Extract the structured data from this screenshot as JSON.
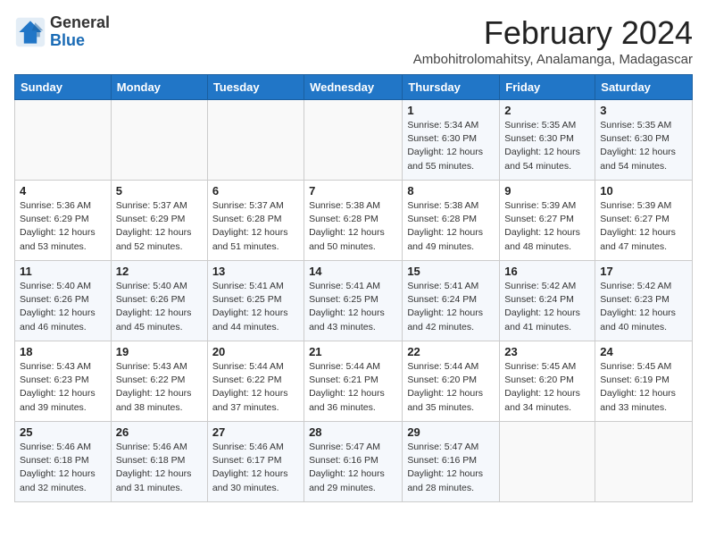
{
  "header": {
    "logo_general": "General",
    "logo_blue": "Blue",
    "title": "February 2024",
    "subtitle": "Ambohitrolomahitsy, Analamanga, Madagascar"
  },
  "weekdays": [
    "Sunday",
    "Monday",
    "Tuesday",
    "Wednesday",
    "Thursday",
    "Friday",
    "Saturday"
  ],
  "weeks": [
    [
      {
        "day": "",
        "info": ""
      },
      {
        "day": "",
        "info": ""
      },
      {
        "day": "",
        "info": ""
      },
      {
        "day": "",
        "info": ""
      },
      {
        "day": "1",
        "info": "Sunrise: 5:34 AM\nSunset: 6:30 PM\nDaylight: 12 hours and 55 minutes."
      },
      {
        "day": "2",
        "info": "Sunrise: 5:35 AM\nSunset: 6:30 PM\nDaylight: 12 hours and 54 minutes."
      },
      {
        "day": "3",
        "info": "Sunrise: 5:35 AM\nSunset: 6:30 PM\nDaylight: 12 hours and 54 minutes."
      }
    ],
    [
      {
        "day": "4",
        "info": "Sunrise: 5:36 AM\nSunset: 6:29 PM\nDaylight: 12 hours and 53 minutes."
      },
      {
        "day": "5",
        "info": "Sunrise: 5:37 AM\nSunset: 6:29 PM\nDaylight: 12 hours and 52 minutes."
      },
      {
        "day": "6",
        "info": "Sunrise: 5:37 AM\nSunset: 6:28 PM\nDaylight: 12 hours and 51 minutes."
      },
      {
        "day": "7",
        "info": "Sunrise: 5:38 AM\nSunset: 6:28 PM\nDaylight: 12 hours and 50 minutes."
      },
      {
        "day": "8",
        "info": "Sunrise: 5:38 AM\nSunset: 6:28 PM\nDaylight: 12 hours and 49 minutes."
      },
      {
        "day": "9",
        "info": "Sunrise: 5:39 AM\nSunset: 6:27 PM\nDaylight: 12 hours and 48 minutes."
      },
      {
        "day": "10",
        "info": "Sunrise: 5:39 AM\nSunset: 6:27 PM\nDaylight: 12 hours and 47 minutes."
      }
    ],
    [
      {
        "day": "11",
        "info": "Sunrise: 5:40 AM\nSunset: 6:26 PM\nDaylight: 12 hours and 46 minutes."
      },
      {
        "day": "12",
        "info": "Sunrise: 5:40 AM\nSunset: 6:26 PM\nDaylight: 12 hours and 45 minutes."
      },
      {
        "day": "13",
        "info": "Sunrise: 5:41 AM\nSunset: 6:25 PM\nDaylight: 12 hours and 44 minutes."
      },
      {
        "day": "14",
        "info": "Sunrise: 5:41 AM\nSunset: 6:25 PM\nDaylight: 12 hours and 43 minutes."
      },
      {
        "day": "15",
        "info": "Sunrise: 5:41 AM\nSunset: 6:24 PM\nDaylight: 12 hours and 42 minutes."
      },
      {
        "day": "16",
        "info": "Sunrise: 5:42 AM\nSunset: 6:24 PM\nDaylight: 12 hours and 41 minutes."
      },
      {
        "day": "17",
        "info": "Sunrise: 5:42 AM\nSunset: 6:23 PM\nDaylight: 12 hours and 40 minutes."
      }
    ],
    [
      {
        "day": "18",
        "info": "Sunrise: 5:43 AM\nSunset: 6:23 PM\nDaylight: 12 hours and 39 minutes."
      },
      {
        "day": "19",
        "info": "Sunrise: 5:43 AM\nSunset: 6:22 PM\nDaylight: 12 hours and 38 minutes."
      },
      {
        "day": "20",
        "info": "Sunrise: 5:44 AM\nSunset: 6:22 PM\nDaylight: 12 hours and 37 minutes."
      },
      {
        "day": "21",
        "info": "Sunrise: 5:44 AM\nSunset: 6:21 PM\nDaylight: 12 hours and 36 minutes."
      },
      {
        "day": "22",
        "info": "Sunrise: 5:44 AM\nSunset: 6:20 PM\nDaylight: 12 hours and 35 minutes."
      },
      {
        "day": "23",
        "info": "Sunrise: 5:45 AM\nSunset: 6:20 PM\nDaylight: 12 hours and 34 minutes."
      },
      {
        "day": "24",
        "info": "Sunrise: 5:45 AM\nSunset: 6:19 PM\nDaylight: 12 hours and 33 minutes."
      }
    ],
    [
      {
        "day": "25",
        "info": "Sunrise: 5:46 AM\nSunset: 6:18 PM\nDaylight: 12 hours and 32 minutes."
      },
      {
        "day": "26",
        "info": "Sunrise: 5:46 AM\nSunset: 6:18 PM\nDaylight: 12 hours and 31 minutes."
      },
      {
        "day": "27",
        "info": "Sunrise: 5:46 AM\nSunset: 6:17 PM\nDaylight: 12 hours and 30 minutes."
      },
      {
        "day": "28",
        "info": "Sunrise: 5:47 AM\nSunset: 6:16 PM\nDaylight: 12 hours and 29 minutes."
      },
      {
        "day": "29",
        "info": "Sunrise: 5:47 AM\nSunset: 6:16 PM\nDaylight: 12 hours and 28 minutes."
      },
      {
        "day": "",
        "info": ""
      },
      {
        "day": "",
        "info": ""
      }
    ]
  ]
}
